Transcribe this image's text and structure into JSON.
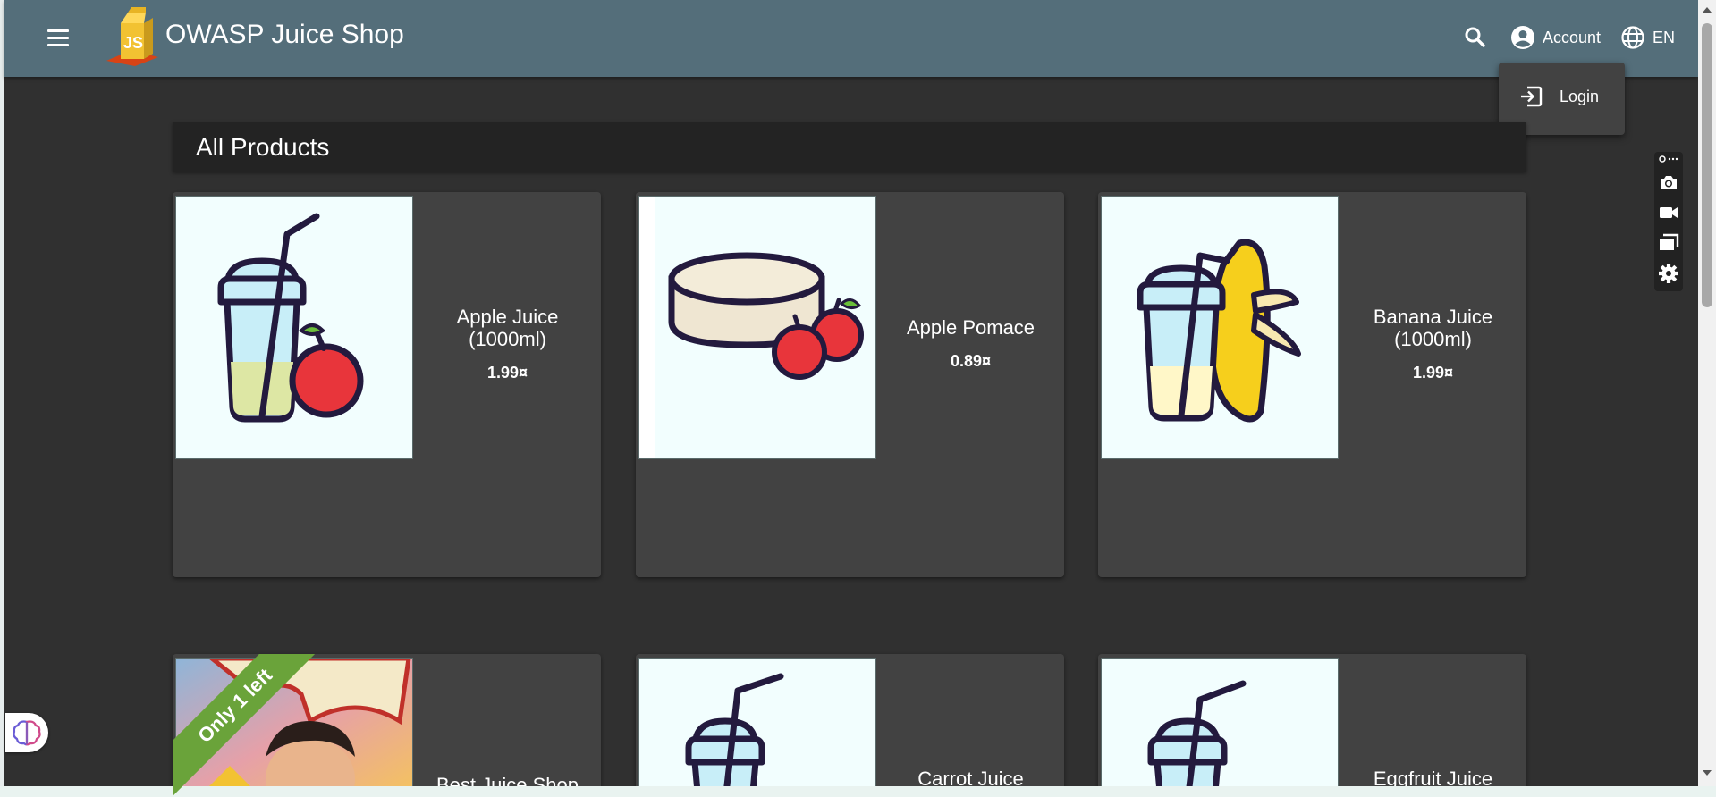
{
  "toolbar": {
    "title": "OWASP Juice Shop",
    "account_label": "Account",
    "language_label": "EN",
    "logo_text": "JS"
  },
  "account_menu": {
    "login_label": "Login"
  },
  "main": {
    "heading": "All Products"
  },
  "products": [
    {
      "name": "Apple Juice (1000ml)",
      "price": "1.99¤",
      "image_icon": "apple-juice-cup-icon"
    },
    {
      "name": "Apple Pomace",
      "price": "0.89¤",
      "image_icon": "apple-pomace-icon"
    },
    {
      "name": "Banana Juice (1000ml)",
      "price": "1.99¤",
      "image_icon": "banana-juice-cup-icon"
    },
    {
      "name": "Best Juice Shop",
      "price": "",
      "badge": "Only 1 left",
      "image_icon": "juice-shop-mascot-image"
    },
    {
      "name": "Carrot Juice",
      "price": "",
      "image_icon": "juice-cup-icon"
    },
    {
      "name": "Eggfruit Juice",
      "price": "",
      "image_icon": "juice-cup-icon"
    }
  ],
  "colors": {
    "toolbar": "#546e7a",
    "background": "#303030",
    "card": "#424242",
    "heading_bar": "#232323",
    "ribbon": "#6aa33a"
  }
}
